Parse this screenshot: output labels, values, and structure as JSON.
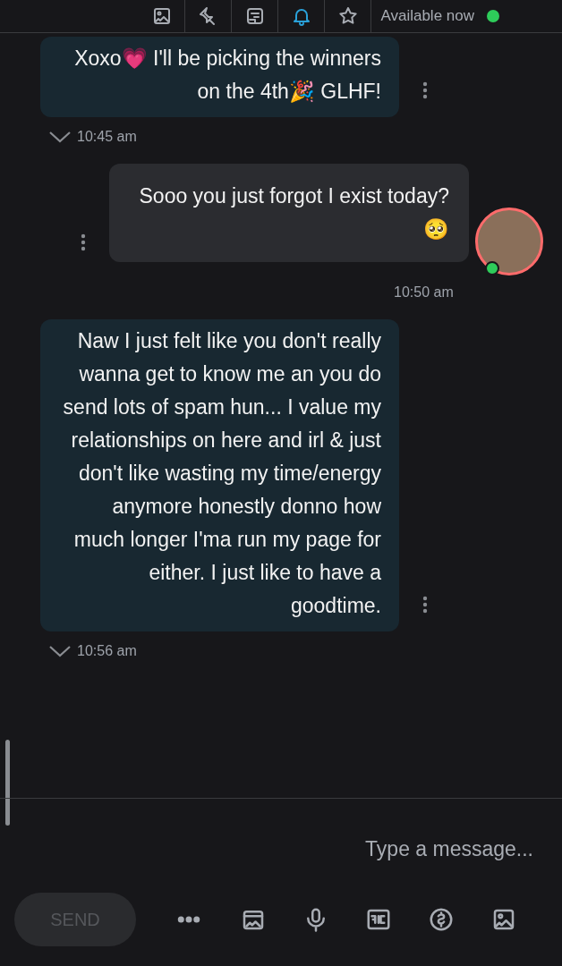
{
  "header": {
    "status": "Available now",
    "online": true,
    "tools": [
      {
        "kind": "star",
        "on": false
      },
      {
        "kind": "bell",
        "on": true
      },
      {
        "kind": "note",
        "on": false
      },
      {
        "kind": "pin",
        "on": false
      },
      {
        "kind": "image",
        "on": false
      }
    ]
  },
  "messages": [
    {
      "kind": "incoming",
      "text": "Xoxo💗 I'll be picking the winners on the 4th🎉 GLHF!",
      "time": "10:45 am"
    },
    {
      "kind": "outgoing",
      "text": "Sooo you just forgot I exist today?🥺",
      "time": "10:50 am",
      "online": true
    },
    {
      "kind": "incoming",
      "text": "Naw I just felt like you don't really wanna get to know me an you do send lots of spam hun... I value my relationships on here and irl & just don't like wasting my time/energy anymore honestly donno how much longer I'ma run my page for either. I just like to have a goodtime.",
      "time": "10:56 am"
    }
  ],
  "composer": {
    "placeholder": "Type a message...",
    "tools": [
      {
        "kind": "image"
      },
      {
        "kind": "dollar"
      },
      {
        "kind": "gif"
      },
      {
        "kind": "mic"
      },
      {
        "kind": "media"
      },
      {
        "kind": "more"
      }
    ],
    "send": {
      "label": "SEND",
      "disabled": true
    }
  }
}
